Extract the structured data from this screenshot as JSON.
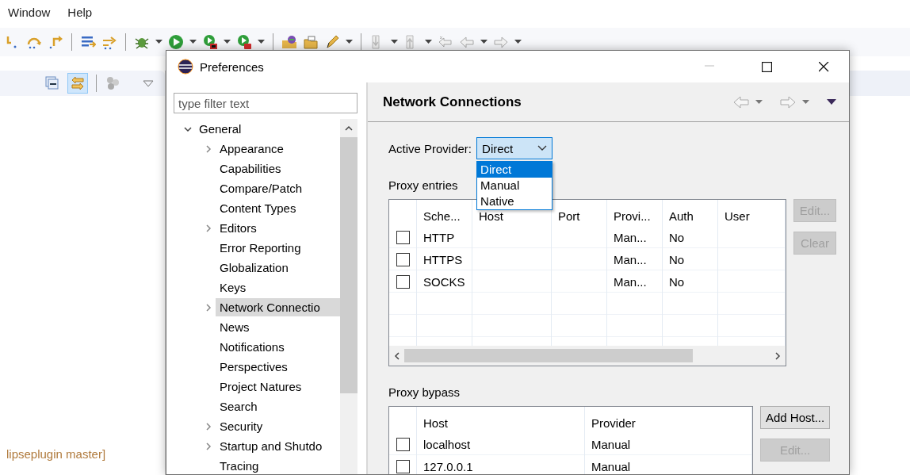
{
  "menubar": [
    {
      "label": "Window"
    },
    {
      "label": "Help"
    }
  ],
  "view": {
    "status_text": "lipseplugin master]"
  },
  "dialog": {
    "title": "Preferences",
    "filter": {
      "placeholder": "type filter text"
    },
    "tree": [
      {
        "label": "General",
        "kind": "branch",
        "expanded": true,
        "selected": false,
        "children": [
          {
            "label": "Appearance",
            "kind": "branch",
            "expanded": false,
            "selected": false
          },
          {
            "label": "Capabilities",
            "kind": "leaf",
            "expanded": false,
            "selected": false
          },
          {
            "label": "Compare/Patch",
            "kind": "leaf",
            "expanded": false,
            "selected": false
          },
          {
            "label": "Content Types",
            "kind": "leaf",
            "expanded": false,
            "selected": false
          },
          {
            "label": "Editors",
            "kind": "branch",
            "expanded": false,
            "selected": false
          },
          {
            "label": "Error Reporting",
            "kind": "leaf",
            "expanded": false,
            "selected": false
          },
          {
            "label": "Globalization",
            "kind": "leaf",
            "expanded": false,
            "selected": false
          },
          {
            "label": "Keys",
            "kind": "leaf",
            "expanded": false,
            "selected": false
          },
          {
            "label": "Network Connectio",
            "kind": "branch",
            "expanded": false,
            "selected": true
          },
          {
            "label": "News",
            "kind": "leaf",
            "expanded": false,
            "selected": false
          },
          {
            "label": "Notifications",
            "kind": "leaf",
            "expanded": false,
            "selected": false
          },
          {
            "label": "Perspectives",
            "kind": "leaf",
            "expanded": false,
            "selected": false
          },
          {
            "label": "Project Natures",
            "kind": "leaf",
            "expanded": false,
            "selected": false
          },
          {
            "label": "Search",
            "kind": "leaf",
            "expanded": false,
            "selected": false
          },
          {
            "label": "Security",
            "kind": "branch",
            "expanded": false,
            "selected": false
          },
          {
            "label": "Startup and Shutdo",
            "kind": "branch",
            "expanded": false,
            "selected": false
          },
          {
            "label": "Tracing",
            "kind": "leaf",
            "expanded": false,
            "selected": false
          }
        ]
      }
    ],
    "page_title": "Network Connections",
    "active_provider": {
      "label": "Active Provider:",
      "value": "Direct",
      "open": true,
      "options": [
        {
          "label": "Direct",
          "selected": true
        },
        {
          "label": "Manual",
          "selected": false
        },
        {
          "label": "Native",
          "selected": false
        }
      ]
    },
    "proxy_entries": {
      "label": "Proxy entries",
      "columns": [
        "Sche...",
        "Host",
        "Port",
        "Provi...",
        "Auth",
        "User"
      ],
      "rows": [
        {
          "checked": false,
          "scheme": "HTTP",
          "provider": "Man...",
          "auth": "No"
        },
        {
          "checked": false,
          "scheme": "HTTPS",
          "provider": "Man...",
          "auth": "No"
        },
        {
          "checked": false,
          "scheme": "SOCKS",
          "provider": "Man...",
          "auth": "No"
        }
      ],
      "buttons": [
        {
          "label": "Edit...",
          "disabled": true
        },
        {
          "label": "Clear",
          "disabled": true
        }
      ]
    },
    "proxy_bypass": {
      "label": "Proxy bypass",
      "columns": [
        "Host",
        "Provider"
      ],
      "rows": [
        {
          "checked": false,
          "host": "localhost",
          "provider": "Manual"
        },
        {
          "checked": false,
          "host": "127.0.0.1",
          "provider": "Manual"
        }
      ],
      "buttons": [
        {
          "label": "Add Host...",
          "disabled": false
        },
        {
          "label": "Edit...",
          "disabled": true
        }
      ]
    }
  }
}
